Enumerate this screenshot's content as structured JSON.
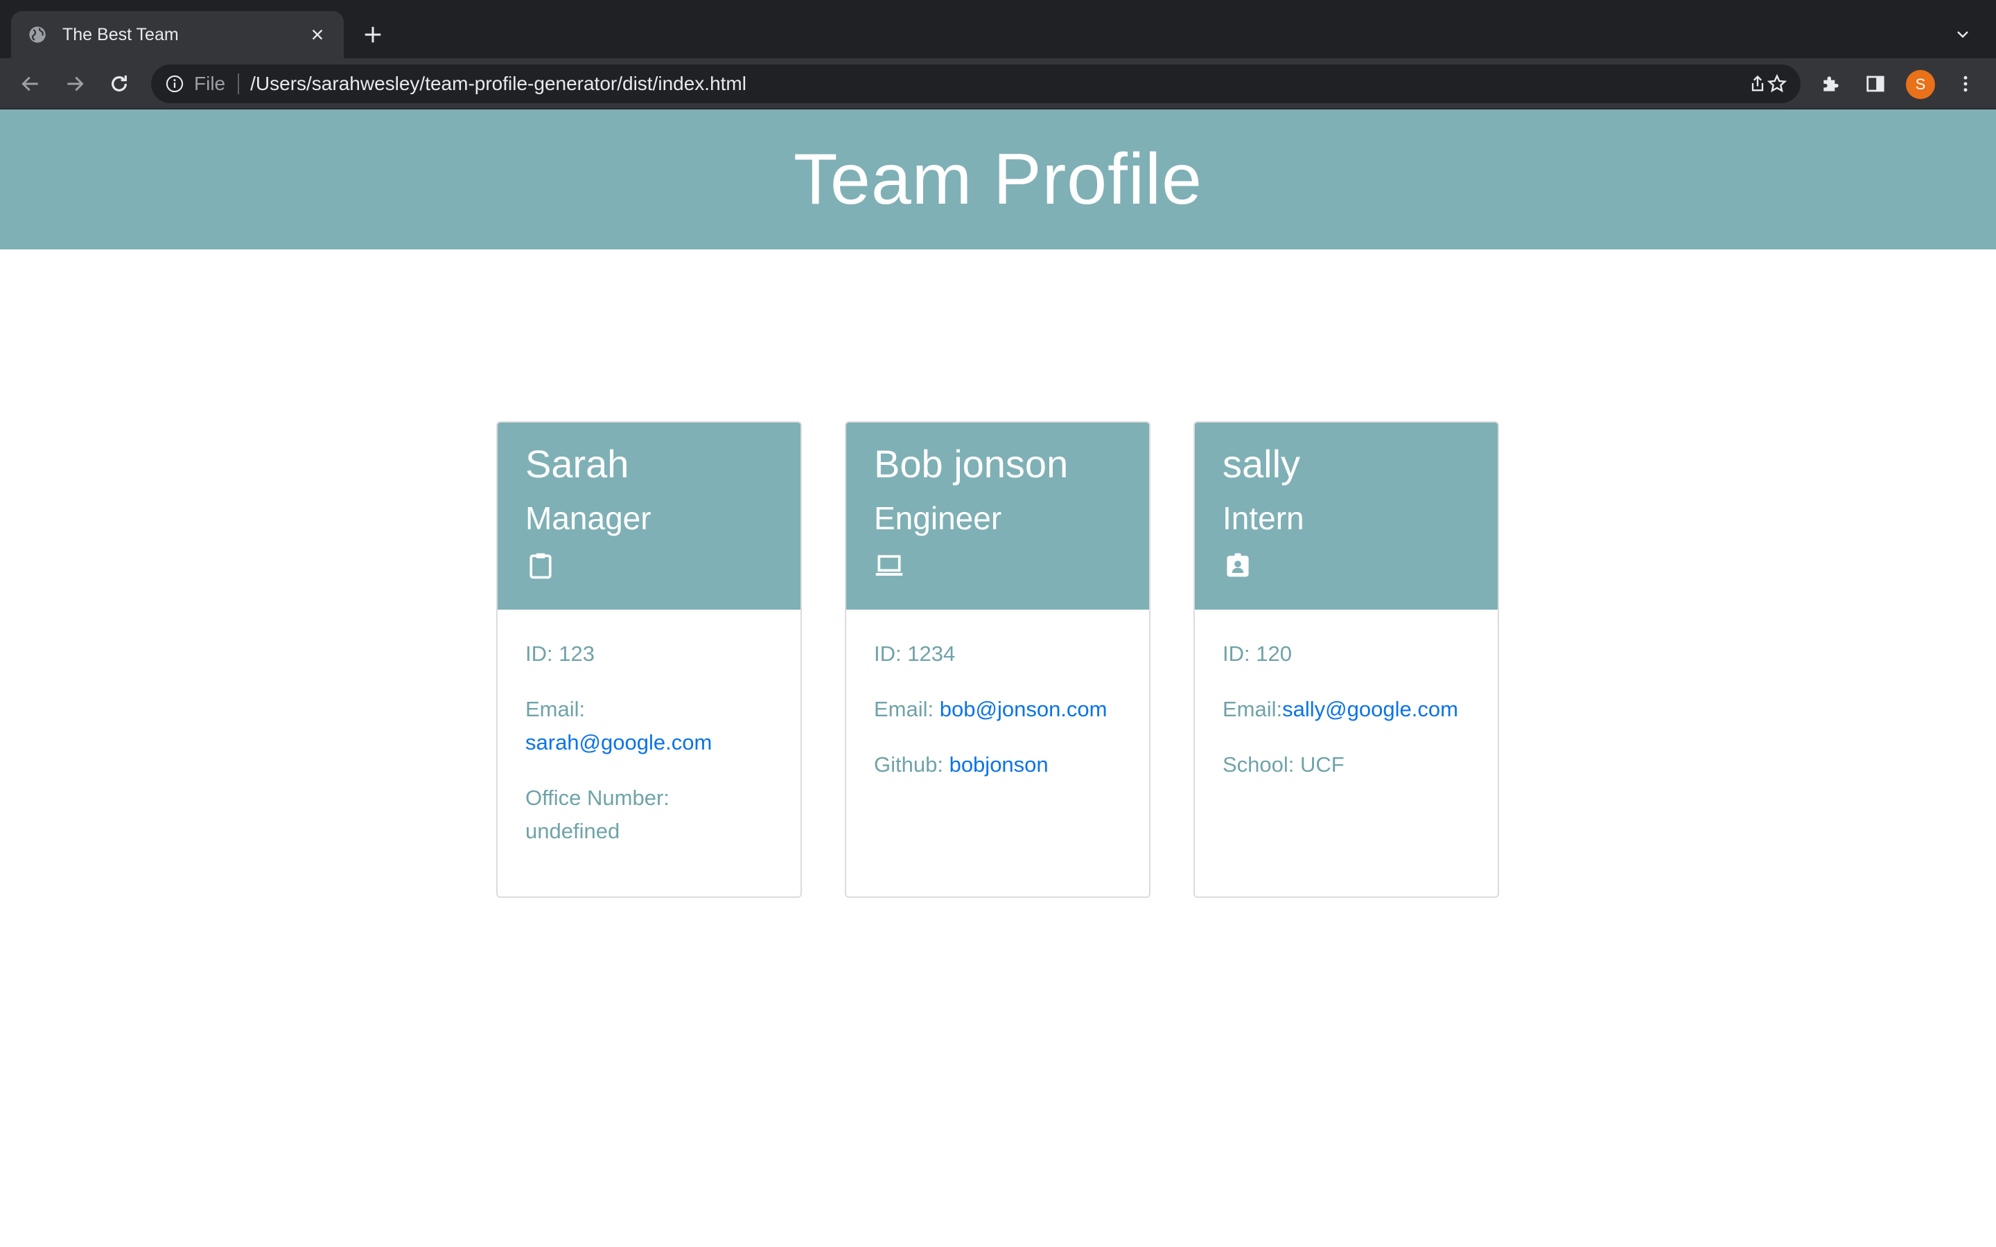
{
  "browser": {
    "tab_title": "The Best Team",
    "url_scheme": "File",
    "url": "/Users/sarahwesley/team-profile-generator/dist/index.html",
    "profile_initial": "S",
    "colors": {
      "frame": "#202124",
      "toolbar": "#35363a",
      "avatar": "#e8711a"
    }
  },
  "page": {
    "title": "Team Profile",
    "colors": {
      "accent": "#7fb0b5",
      "label": "#6fa3a8",
      "link": "#0b73e8"
    }
  },
  "cards": [
    {
      "name": "Sarah",
      "role": "Manager",
      "icon": "clipboard-icon",
      "id_text": "ID: 123",
      "email_label": "Email:",
      "email": "sarah@google.com",
      "extra_label": "Office Number:",
      "extra_value": "undefined"
    },
    {
      "name": "Bob jonson",
      "role": "Engineer",
      "icon": "laptop-icon",
      "id_text": "ID: 1234",
      "email_label": "Email:",
      "email": "bob@jonson.com",
      "extra_label": "Github:",
      "extra_value": "bobjonson"
    },
    {
      "name": "sally",
      "role": "Intern",
      "icon": "id-badge-icon",
      "id_text": "ID: 120",
      "email_label": "Email:",
      "email": "sally@google.com",
      "extra_label": "School:",
      "extra_value": "UCF"
    }
  ]
}
